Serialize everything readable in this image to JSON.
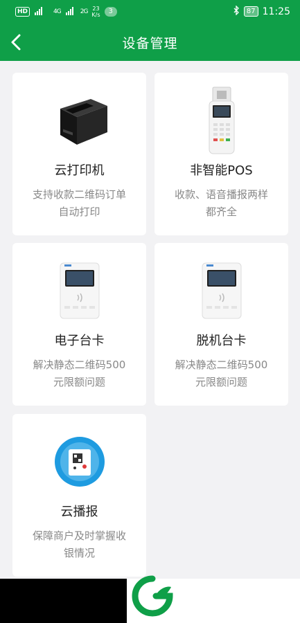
{
  "status_bar": {
    "hd": "HD",
    "net1": "4G",
    "net2": "2G",
    "speed_value": "23",
    "speed_unit": "K/s",
    "notification_count": "3",
    "battery": "87",
    "time": "11:25"
  },
  "nav": {
    "title": "设备管理"
  },
  "devices": [
    {
      "name": "云打印机",
      "desc": "支持收款二维码订单自动打印",
      "icon": "printer-icon"
    },
    {
      "name": "非智能POS",
      "desc": "收款、语音播报两样都齐全",
      "icon": "pos-terminal-icon"
    },
    {
      "name": "电子台卡",
      "desc": "解决静态二维码500元限额问题",
      "icon": "e-card-device-icon"
    },
    {
      "name": "脱机台卡",
      "desc": "解决静态二维码500元限额问题",
      "icon": "offline-card-device-icon"
    },
    {
      "name": "云播报",
      "desc": "保障商户及时掌握收银情况",
      "icon": "cloud-speaker-icon"
    }
  ],
  "colors": {
    "brand": "#0f9f48",
    "background": "#f2f2f4"
  }
}
